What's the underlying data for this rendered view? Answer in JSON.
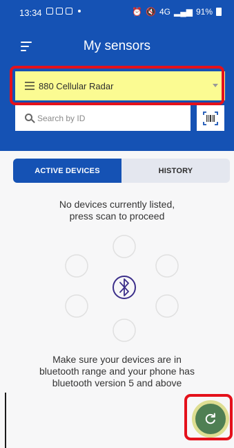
{
  "status_bar": {
    "time": "13:34",
    "battery": "91%",
    "network": "4G"
  },
  "header": {
    "title": "My sensors"
  },
  "device_selector": {
    "selected": "880 Cellular Radar"
  },
  "search": {
    "placeholder": "Search by ID",
    "value": ""
  },
  "tabs": [
    {
      "label": "ACTIVE DEVICES",
      "active": true
    },
    {
      "label": "HISTORY",
      "active": false
    }
  ],
  "empty_state": {
    "message_line1": "No devices currently listed,",
    "message_line2": "press scan to proceed",
    "hint_line1": "Make sure your devices are in",
    "hint_line2": "bluetooth range and your phone has",
    "hint_line3": "bluetooth version 5 and above"
  },
  "colors": {
    "brand_blue": "#1552b4",
    "highlight_yellow": "#fbfb92",
    "annotation_red": "#e4111b",
    "refresh_green": "#4f7f53"
  }
}
